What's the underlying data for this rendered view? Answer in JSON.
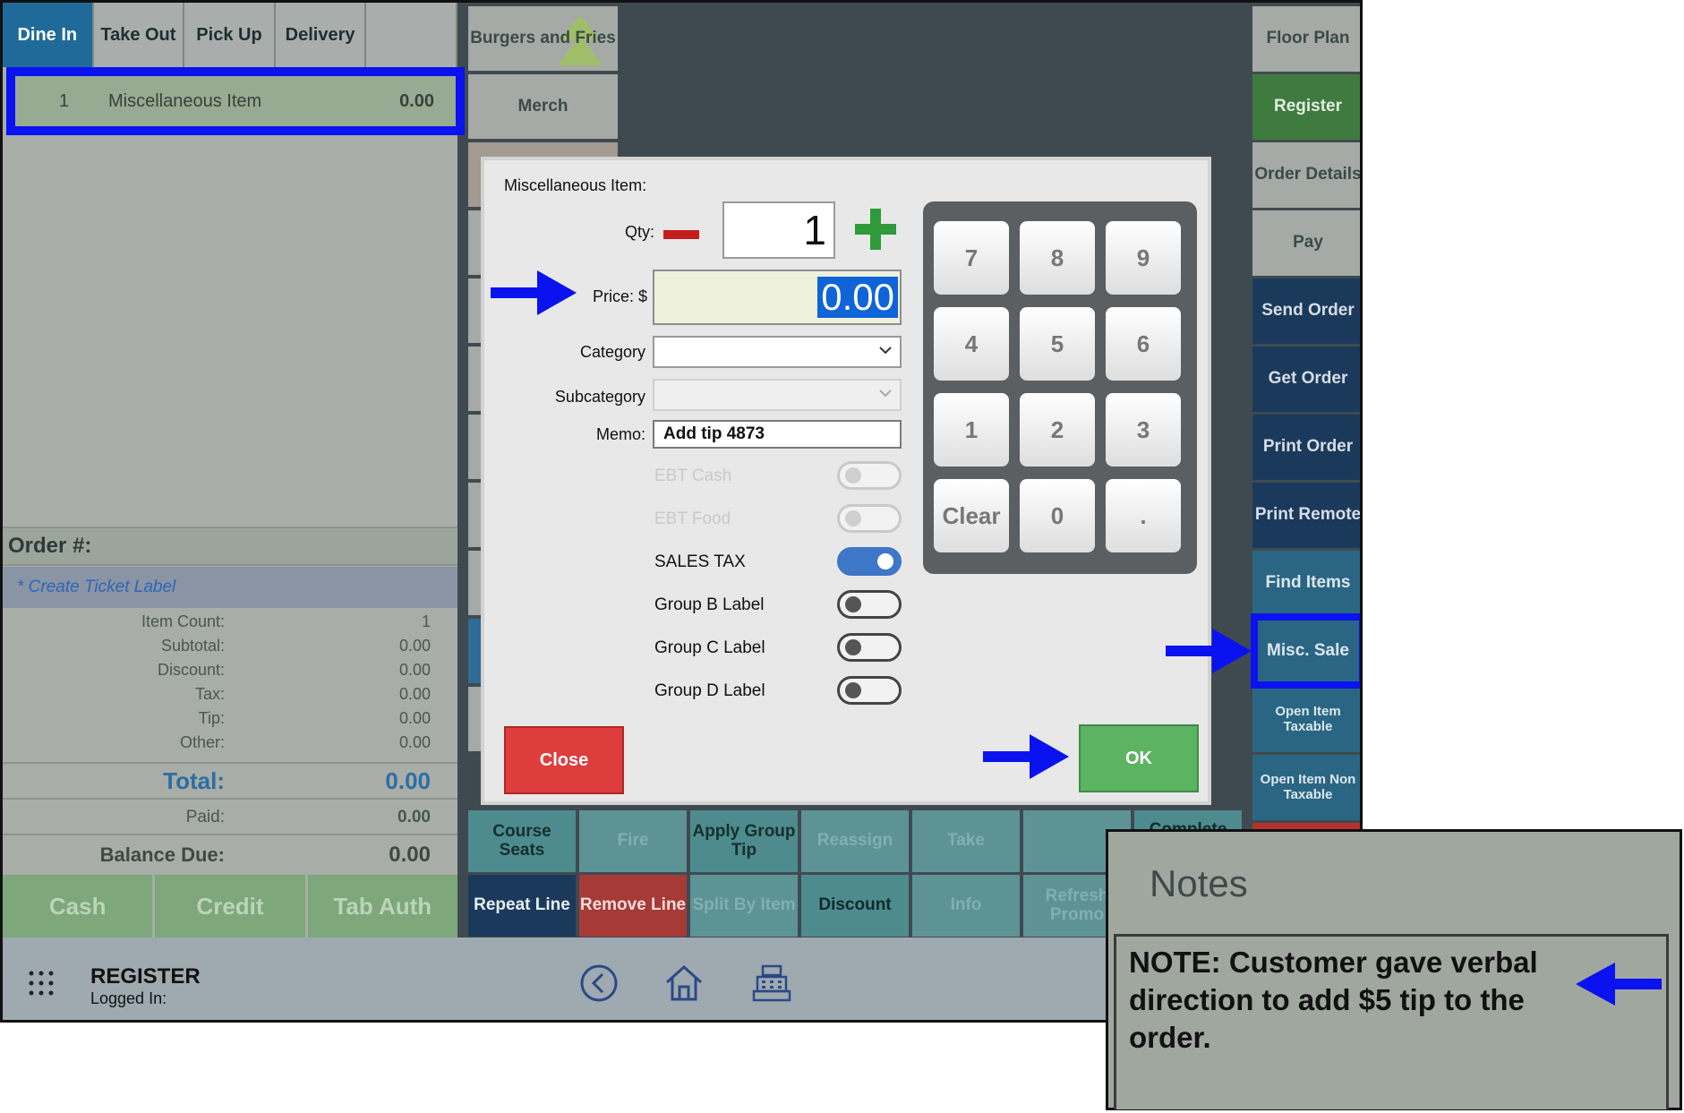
{
  "order_tabs": [
    {
      "label": "Dine In"
    },
    {
      "label": "Take Out"
    },
    {
      "label": "Pick Up"
    },
    {
      "label": "Delivery"
    },
    {
      "label": ""
    }
  ],
  "line_item": {
    "qty": "1",
    "name": "Miscellaneous Item",
    "amount": "0.00"
  },
  "order_number_label": "Order #:",
  "ticket_label": "* Create Ticket Label",
  "totals": [
    {
      "label": "Item Count:",
      "value": "1"
    },
    {
      "label": "Subtotal:",
      "value": "0.00"
    },
    {
      "label": "Discount:",
      "value": "0.00"
    },
    {
      "label": "Tax:",
      "value": "0.00"
    },
    {
      "label": "Tip:",
      "value": "0.00"
    },
    {
      "label": "Other:",
      "value": "0.00"
    }
  ],
  "total": {
    "label": "Total:",
    "value": "0.00"
  },
  "paid": {
    "label": "Paid:",
    "value": "0.00"
  },
  "balance": {
    "label": "Balance Due:",
    "value": "0.00"
  },
  "pay_buttons": {
    "cash": "Cash",
    "credit": "Credit",
    "tab_auth": "Tab Auth"
  },
  "categories": {
    "burgers": "Burgers and Fries",
    "merch": "Merch"
  },
  "functions": {
    "floor_plan": "Floor Plan",
    "register": "Register",
    "order_details": "Order Details",
    "pay": "Pay",
    "send_order": "Send Order",
    "get_order": "Get Order",
    "print_order": "Print Order",
    "print_remote": "Print Remote",
    "find_items": "Find Items",
    "misc_sale": "Misc. Sale",
    "open_item_taxable": "Open Item Taxable",
    "open_item_non_taxable": "Open Item Non Taxable"
  },
  "actions": {
    "course_seats": "Course Seats",
    "fire": "Fire",
    "apply_group_tip": "Apply Group Tip",
    "reassign": "Reassign",
    "take": "Take",
    "complete": "Complete",
    "repeat_line": "Repeat Line",
    "remove_line": "Remove Line",
    "split_by_item": "Split By Item",
    "discount": "Discount",
    "info": "Info",
    "refresh_promo": "Refresh Promo"
  },
  "bottom_bar": {
    "title": "REGISTER",
    "subtitle": "Logged In:"
  },
  "modal": {
    "title": "Miscellaneous Item:",
    "qty_label": "Qty:",
    "qty_value": "1",
    "price_label": "Price: $",
    "price_value": "0.00",
    "category_label": "Category",
    "subcategory_label": "Subcategory",
    "memo_label": "Memo:",
    "memo_value": "Add tip 4873",
    "toggles": [
      {
        "label": "EBT Cash",
        "on": false,
        "disabled": true
      },
      {
        "label": "EBT Food",
        "on": false,
        "disabled": true
      },
      {
        "label": "SALES TAX",
        "on": true,
        "disabled": false
      },
      {
        "label": "Group B Label",
        "on": false,
        "disabled": false
      },
      {
        "label": "Group C Label",
        "on": false,
        "disabled": false
      },
      {
        "label": "Group D Label",
        "on": false,
        "disabled": false
      }
    ],
    "keypad": [
      "7",
      "8",
      "9",
      "4",
      "5",
      "6",
      "1",
      "2",
      "3",
      "Clear",
      "0",
      "."
    ],
    "close_label": "Close",
    "ok_label": "OK"
  },
  "notes": {
    "title": "Notes",
    "text": "NOTE: Customer gave verbal direction to add $5 tip to the order."
  },
  "colors": {
    "highlight": "#0a12f0",
    "accent_blue": "#1f6a98",
    "ok_green": "#5cb362",
    "close_red": "#dd3d3d"
  }
}
